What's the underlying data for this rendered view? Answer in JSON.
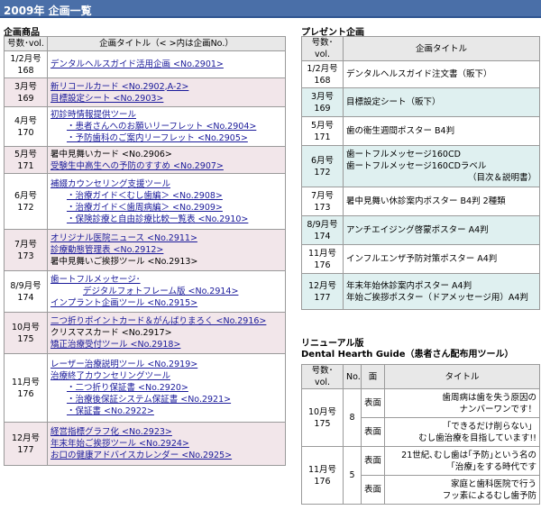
{
  "page_title": "2009年 企画一覧",
  "left": {
    "heading": "企画商品",
    "col_issue": "号数･vol.",
    "col_title": "企画タイトル（< >内は企画No.）",
    "rows": [
      {
        "issue": "1/2月号",
        "vol": "168",
        "lines": [
          "デンタルヘルスガイド活用企画 <No.2901>"
        ]
      },
      {
        "issue": "3月号",
        "vol": "169",
        "lines": [
          "新リコールカード <No.2902,A-2>",
          "目標設定シート <No.2903>"
        ]
      },
      {
        "issue": "4月号",
        "vol": "170",
        "lines": [
          "初診時情報提供ツール",
          "・患者さんへのお願いリーフレット <No.2904>",
          "・予防歯科のご案内リーフレット <No.2905>"
        ]
      },
      {
        "issue": "5月号",
        "vol": "171",
        "lines": [
          "暑中見舞いカード <No.2906>",
          "受験生中高生への予防のすすめ <No.2907>"
        ]
      },
      {
        "issue": "6月号",
        "vol": "172",
        "lines": [
          "補綴カウンセリング支援ツール",
          "・治療ガイド＜むし歯編＞ <No.2908>",
          "・治療ガイド＜歯周病編＞ <No.2909>",
          "・保険診療と自由診療比較一覧表 <No.2910>"
        ]
      },
      {
        "issue": "7月号",
        "vol": "173",
        "lines": [
          "オリジナル医院ニュース <No.2911>",
          "診療動態管理表 <No.2912>",
          "暑中見舞いご挨拶ツール <No.2913>"
        ]
      },
      {
        "issue": "8/9月号",
        "vol": "174",
        "lines": [
          "歯ートフルメッセージ･",
          "デジタルフォトフレーム版 <No.2914>",
          "インプラント企画ツール <No.2915>"
        ]
      },
      {
        "issue": "10月号",
        "vol": "175",
        "lines": [
          "二つ折りポイントカード＆がんばりまろく <No.2916>",
          "クリスマスカード <No.2917>",
          "矯正治療受付ツール <No.2918>"
        ]
      },
      {
        "issue": "11月号",
        "vol": "176",
        "lines": [
          "レーザー治療説明ツール <No.2919>",
          "治療終了カウンセリングツール",
          "・二つ折り保証書 <No.2920>",
          "・治療後保証システム保証書 <No.2921>",
          "・保証書 <No.2922>"
        ]
      },
      {
        "issue": "12月号",
        "vol": "177",
        "lines": [
          "経営指標グラフ化 <No.2923>",
          "年末年始ご挨拶ツール <No.2924>",
          "お口の健康アドバイスカレンダー <No.2925>"
        ]
      }
    ]
  },
  "right": {
    "heading": "プレゼント企画",
    "col_issue": "号数･vol.",
    "col_title": "企画タイトル",
    "rows": [
      {
        "issue": "1/2月号",
        "vol": "168",
        "lines": [
          "デンタルヘルスガイド注文書（販下）"
        ]
      },
      {
        "issue": "3月号",
        "vol": "169",
        "lines": [
          "目標設定シート（販下）"
        ]
      },
      {
        "issue": "5月号",
        "vol": "171",
        "lines": [
          "歯の衛生週間ポスター B4判"
        ]
      },
      {
        "issue": "6月号",
        "vol": "172",
        "lines": [
          "歯ートフルメッセージ160CD",
          "歯ートフルメッセージ160CDラベル",
          "（目次＆説明書）"
        ]
      },
      {
        "issue": "7月号",
        "vol": "173",
        "lines": [
          "暑中見舞い休診案内ポスター B4判 2種類"
        ]
      },
      {
        "issue": "8/9月号",
        "vol": "174",
        "lines": [
          "アンチエイジング啓蒙ポスター A4判"
        ]
      },
      {
        "issue": "11月号",
        "vol": "176",
        "lines": [
          "インフルエンザ予防対策ポスター A4判"
        ]
      },
      {
        "issue": "12月号",
        "vol": "177",
        "lines": [
          "年末年始休診案内ポスター A4判",
          "年始ご挨拶ポスター（ドアメッセージ用）A4判"
        ]
      }
    ]
  },
  "renewal": {
    "heading1": "リニューアル版",
    "heading2": "Dental Hearth Guide（患者さん配布用ツール）",
    "col_issue": "号数･vol.",
    "col_no": "No.",
    "col_face": "面",
    "col_title": "タイトル",
    "rows": [
      {
        "issue": "10月号",
        "vol": "175",
        "no": "8",
        "faces": [
          {
            "face": "表面",
            "lines": [
              "歯周病は歯を失う原因の",
              "ナンバーワンです！"
            ]
          },
          {
            "face": "表面",
            "lines": [
              "「できるだけ削らない」",
              "むし歯治療を目指しています!!"
            ]
          }
        ]
      },
      {
        "issue": "11月号",
        "vol": "176",
        "no": "5",
        "faces": [
          {
            "face": "表面",
            "lines": [
              "21世紀､むし歯は｢予防｣という名の",
              "｢治療｣をする時代です"
            ]
          },
          {
            "face": "表面",
            "lines": [
              "家庭と歯科医院で行う",
              "フッ素によるむし歯予防"
            ]
          }
        ]
      }
    ]
  }
}
